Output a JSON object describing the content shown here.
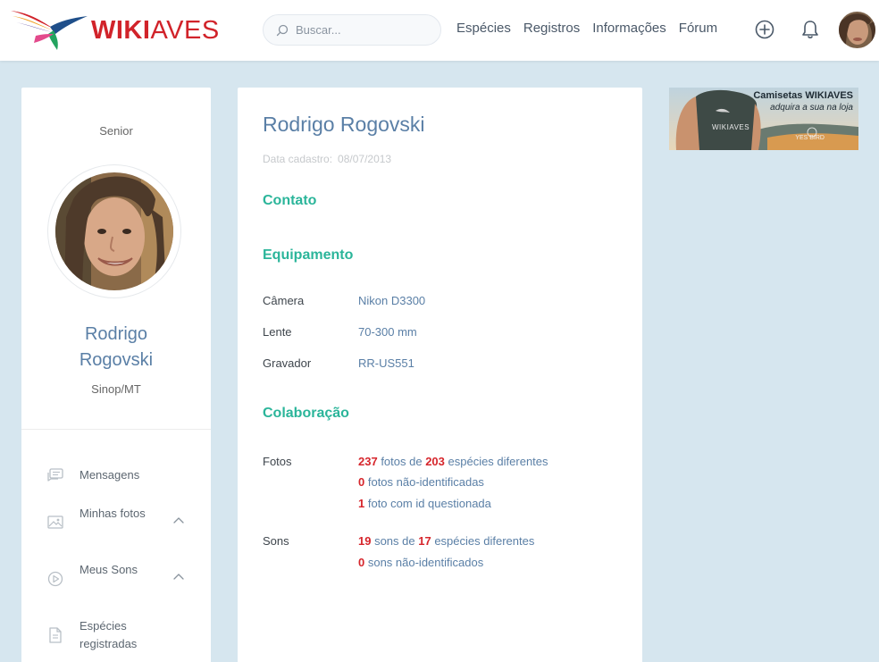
{
  "header": {
    "logo_wiki": "WIKI",
    "logo_aves": "AVES",
    "search_placeholder": "Buscar...",
    "nav": [
      "Espécies",
      "Registros",
      "Informações",
      "Fórum"
    ]
  },
  "profile": {
    "level": "Senior",
    "name_line1": "Rodrigo",
    "name_line2": "Rogovski",
    "full_name": "Rodrigo Rogovski",
    "location": "Sinop/MT",
    "registration_label": "Data cadastro:",
    "registration_date": "08/07/2013"
  },
  "menu": [
    {
      "label": "Mensagens",
      "icon": "messages-icon"
    },
    {
      "label": "Minhas fotos",
      "icon": "image-icon"
    },
    {
      "label": "Meus Sons",
      "icon": "play-icon"
    },
    {
      "label": "Espécies registradas",
      "icon": "document-icon"
    }
  ],
  "sections": {
    "contato": "Contato",
    "equipamento": "Equipamento",
    "colaboracao": "Colaboração"
  },
  "equipment": [
    {
      "label": "Câmera",
      "value": "Nikon D3300"
    },
    {
      "label": "Lente",
      "value": "70-300 mm"
    },
    {
      "label": "Gravador",
      "value": "RR-US551"
    }
  ],
  "collaboration": {
    "photos_label": "Fotos",
    "photos_count": "237",
    "photos_text1": " fotos de ",
    "photos_species": "203",
    "photos_text2": " espécies diferentes",
    "photos_unidentified": "0",
    "photos_unidentified_text": " fotos não-identificadas",
    "photos_questioned": "1",
    "photos_questioned_text": " foto com id questionada",
    "sounds_label": "Sons",
    "sounds_count": "19",
    "sounds_text1": " sons de ",
    "sounds_species": "17",
    "sounds_text2": " espécies diferentes",
    "sounds_unidentified": "0",
    "sounds_unidentified_text": " sons não-identificados"
  },
  "ad": {
    "title": "Camisetas WIKIAVES",
    "subtitle": "adquira a sua na loja",
    "shirt_brand": "WIKIAVES",
    "yesbird": "YES BIRD"
  },
  "colors": {
    "accent_green": "#2bb59a",
    "name_blue": "#5a7fa6",
    "number_red": "#d6262c",
    "brand_red": "#d1232a",
    "page_bg": "#d6e6ef"
  }
}
